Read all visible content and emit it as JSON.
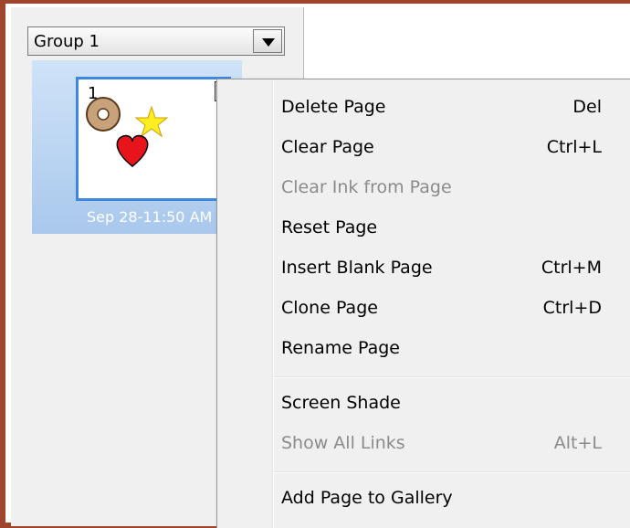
{
  "group_selector": {
    "value": "Group 1"
  },
  "page_thumbnail": {
    "number": "1",
    "date": "Sep 28-11:50 AM"
  },
  "context_menu": {
    "items": [
      {
        "label": "Delete Page",
        "shortcut": "Del",
        "enabled": true
      },
      {
        "label": "Clear Page",
        "shortcut": "Ctrl+L",
        "enabled": true
      },
      {
        "label": "Clear Ink from Page",
        "shortcut": "",
        "enabled": false
      },
      {
        "label": "Reset Page",
        "shortcut": "",
        "enabled": true
      },
      {
        "label": "Insert Blank Page",
        "shortcut": "Ctrl+M",
        "enabled": true
      },
      {
        "label": "Clone Page",
        "shortcut": "Ctrl+D",
        "enabled": true
      },
      {
        "label": "Rename Page",
        "shortcut": "",
        "enabled": true
      },
      {
        "label": "Screen Shade",
        "shortcut": "",
        "enabled": true
      },
      {
        "label": "Show All Links",
        "shortcut": "Alt+L",
        "enabled": false
      },
      {
        "label": "Add Page to Gallery",
        "shortcut": "",
        "enabled": true
      }
    ]
  },
  "colors": {
    "frame_border": "#a0452c",
    "selection_blue": "#3d87e0",
    "menu_background": "#f0f0f0",
    "disabled_text": "#8b8b8b"
  }
}
